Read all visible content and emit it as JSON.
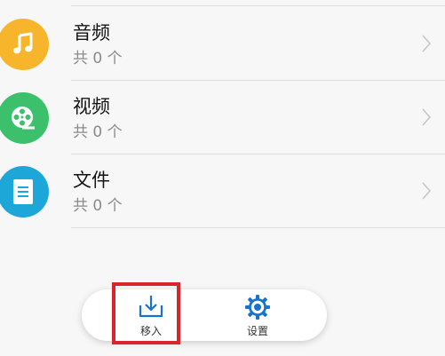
{
  "list": {
    "items": [
      {
        "title": "音频",
        "count": "共 0 个",
        "icon": "music-note-icon",
        "color": "#f7b52c"
      },
      {
        "title": "视频",
        "count": "共 0 个",
        "icon": "film-reel-icon",
        "color": "#3cc06b"
      },
      {
        "title": "文件",
        "count": "共 0 个",
        "icon": "document-icon",
        "color": "#1da7d9"
      }
    ]
  },
  "bottom_bar": {
    "move_in_label": "移入",
    "settings_label": "设置",
    "accent_color": "#1a73c9"
  },
  "highlight_color": "#d8242a"
}
